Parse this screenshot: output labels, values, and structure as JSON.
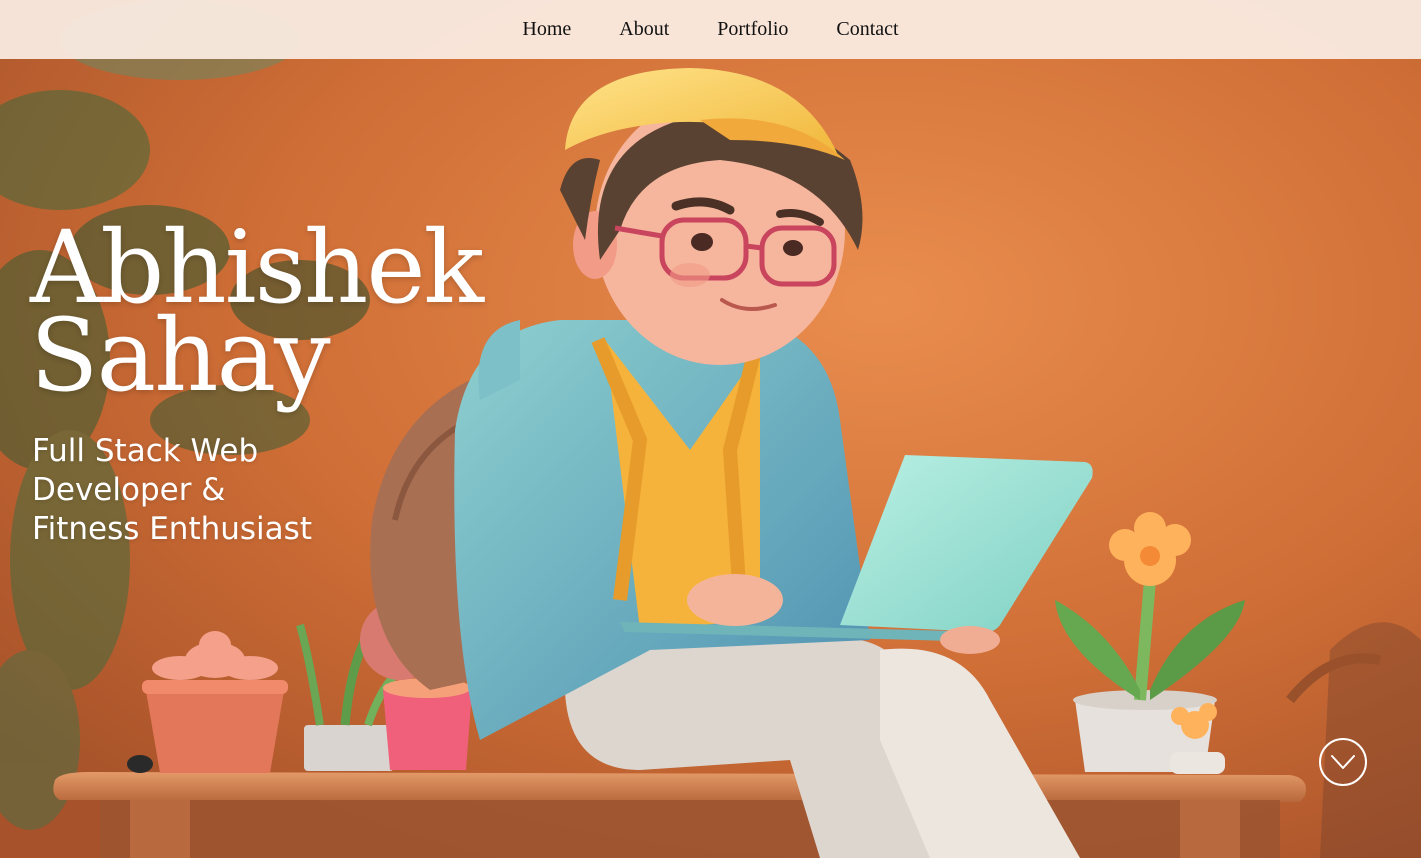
{
  "nav": {
    "items": [
      {
        "label": "Home"
      },
      {
        "label": "About"
      },
      {
        "label": "Portfolio"
      },
      {
        "label": "Contact"
      }
    ]
  },
  "hero": {
    "name_line1": "Abhishek",
    "name_line2": "Sahay",
    "tagline": "Full Stack Web Developer & Fitness Enthusiast",
    "scroll_icon": "chevron-down-icon",
    "illustration": "3d-character-with-laptop"
  },
  "colors": {
    "background_orange": "#d4763a",
    "nav_bg": "#faece2",
    "text_white": "#ffffff"
  }
}
